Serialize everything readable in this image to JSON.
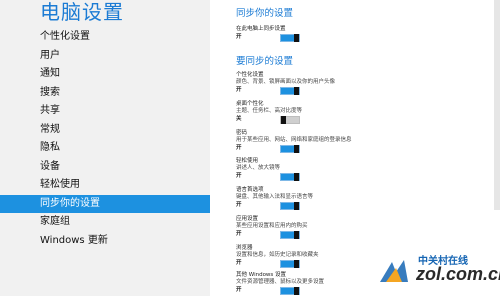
{
  "app": {
    "title": "电脑设置"
  },
  "sidebar": {
    "items": [
      {
        "label": "个性化设置"
      },
      {
        "label": "用户"
      },
      {
        "label": "通知"
      },
      {
        "label": "搜索"
      },
      {
        "label": "共享"
      },
      {
        "label": "常规"
      },
      {
        "label": "隐私"
      },
      {
        "label": "设备"
      },
      {
        "label": "轻松使用"
      },
      {
        "label": "同步你的设置",
        "active": true
      },
      {
        "label": "家庭组"
      },
      {
        "label": "Windows 更新"
      }
    ]
  },
  "main": {
    "section1_title": "同步你的设置",
    "section2_title": "要同步的设置",
    "settings": [
      {
        "label": "在此电脑上同步设置",
        "desc": "",
        "state": "开",
        "on": true
      },
      {
        "label": "个性化设置",
        "desc": "颜色、背景、锁屏画面以及你的用户头像",
        "state": "开",
        "on": true
      },
      {
        "label": "桌面个性化",
        "desc": "主题、任务栏、高对比度等",
        "state": "关",
        "on": false
      },
      {
        "label": "密码",
        "desc": "用于某些应用、网站、网络和家庭组的登录信息",
        "state": "开",
        "on": true
      },
      {
        "label": "轻松使用",
        "desc": "讲述人、放大镜等",
        "state": "开",
        "on": true
      },
      {
        "label": "语言首选项",
        "desc": "键盘、其他输入法和显示语言等",
        "state": "开",
        "on": true
      },
      {
        "label": "应用设置",
        "desc": "某些应用设置和应用内的购买",
        "state": "开",
        "on": true
      },
      {
        "label": "浏览器",
        "desc": "设置和信息，如历史记录和收藏夹",
        "state": "开",
        "on": true
      },
      {
        "label": "其他 Windows 设置",
        "desc": "文件资源管理器、鼠标以及更多设置",
        "state": "开",
        "on": true
      }
    ]
  },
  "watermark": {
    "cn": "中关村在线",
    "en": "zol.com.cn"
  },
  "colors": {
    "accent": "#1d91e0",
    "title": "#1b7bd4",
    "sidebar_bg": "#f1f1f1"
  }
}
